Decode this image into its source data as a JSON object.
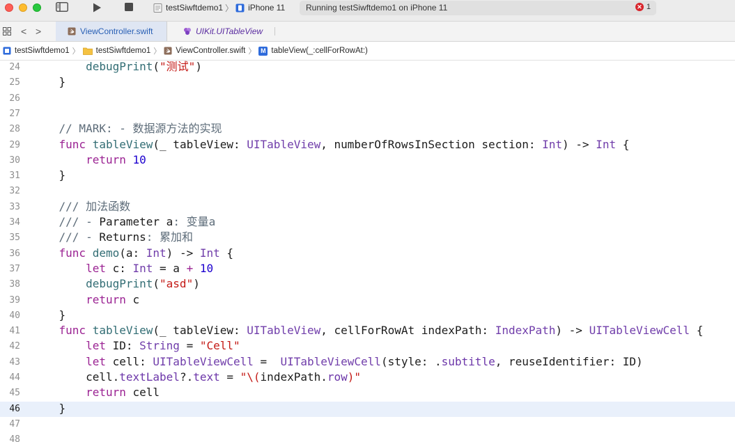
{
  "toolbar": {
    "scheme_project": "testSiwftdemo1",
    "device": "iPhone 11",
    "status_text": "Running testSiwftdemo1 on iPhone 11",
    "error_count": "1"
  },
  "tabs": {
    "active_label": "ViewController.swift",
    "other_label": "UIKit.UITableView"
  },
  "breadcrumb": {
    "project": "testSiwftdemo1",
    "folder": "testSiwftdemo1",
    "file": "ViewController.swift",
    "method_badge": "M",
    "method": "tableView(_:cellForRowAt:)"
  },
  "colors": {
    "keyword": "#9b2393",
    "type": "#703daa",
    "string": "#c41a16",
    "number": "#1c00cf",
    "function": "#326d74",
    "comment": "#5d6c79",
    "current_line": "#e9f0fb"
  },
  "editor": {
    "current_line": "46",
    "lines": [
      {
        "n": "24",
        "tokens": [
          [
            "sp",
            "        "
          ],
          [
            "fn",
            "debugPrint"
          ],
          [
            "sp",
            "("
          ],
          [
            "str",
            "\"测试\""
          ],
          [
            "sp",
            ")"
          ]
        ]
      },
      {
        "n": "25",
        "tokens": [
          [
            "sp",
            "    }"
          ]
        ]
      },
      {
        "n": "26",
        "tokens": []
      },
      {
        "n": "27",
        "tokens": []
      },
      {
        "n": "28",
        "tokens": [
          [
            "sp",
            "    "
          ],
          [
            "cm",
            "// MARK: - 数据源方法的实现"
          ]
        ]
      },
      {
        "n": "29",
        "tokens": [
          [
            "sp",
            "    "
          ],
          [
            "kw",
            "func"
          ],
          [
            "sp",
            " "
          ],
          [
            "fn",
            "tableView"
          ],
          [
            "sp",
            "(_ tableView: "
          ],
          [
            "ty",
            "UITableView"
          ],
          [
            "sp",
            ", numberOfRowsInSection section: "
          ],
          [
            "ty",
            "Int"
          ],
          [
            "sp",
            ") -> "
          ],
          [
            "ty",
            "Int"
          ],
          [
            "sp",
            " {"
          ]
        ]
      },
      {
        "n": "30",
        "tokens": [
          [
            "sp",
            "        "
          ],
          [
            "kw",
            "return"
          ],
          [
            "sp",
            " "
          ],
          [
            "num",
            "10"
          ]
        ]
      },
      {
        "n": "31",
        "tokens": [
          [
            "sp",
            "    }"
          ]
        ]
      },
      {
        "n": "32",
        "tokens": []
      },
      {
        "n": "33",
        "tokens": [
          [
            "sp",
            "    "
          ],
          [
            "cm",
            "/// 加法函数"
          ]
        ]
      },
      {
        "n": "34",
        "tokens": [
          [
            "sp",
            "    "
          ],
          [
            "cm",
            "/// - "
          ],
          [
            "cmt",
            "Parameter"
          ],
          [
            "cm",
            " "
          ],
          [
            "cmt",
            "a"
          ],
          [
            "cm",
            ": 变量a"
          ]
        ]
      },
      {
        "n": "35",
        "tokens": [
          [
            "sp",
            "    "
          ],
          [
            "cm",
            "/// - "
          ],
          [
            "cmt",
            "Returns"
          ],
          [
            "cm",
            ": 累加和"
          ]
        ]
      },
      {
        "n": "36",
        "tokens": [
          [
            "sp",
            "    "
          ],
          [
            "kw",
            "func"
          ],
          [
            "sp",
            " "
          ],
          [
            "fn",
            "demo"
          ],
          [
            "sp",
            "(a: "
          ],
          [
            "ty",
            "Int"
          ],
          [
            "sp",
            ") -> "
          ],
          [
            "ty",
            "Int"
          ],
          [
            "sp",
            " {"
          ]
        ]
      },
      {
        "n": "37",
        "tokens": [
          [
            "sp",
            "        "
          ],
          [
            "kw",
            "let"
          ],
          [
            "sp",
            " c: "
          ],
          [
            "ty",
            "Int"
          ],
          [
            "sp",
            " = a "
          ],
          [
            "kw",
            "+"
          ],
          [
            "sp",
            " "
          ],
          [
            "num",
            "10"
          ]
        ]
      },
      {
        "n": "38",
        "tokens": [
          [
            "sp",
            "        "
          ],
          [
            "fn",
            "debugPrint"
          ],
          [
            "sp",
            "("
          ],
          [
            "str",
            "\"asd\""
          ],
          [
            "sp",
            ")"
          ]
        ]
      },
      {
        "n": "39",
        "tokens": [
          [
            "sp",
            "        "
          ],
          [
            "kw",
            "return"
          ],
          [
            "sp",
            " c"
          ]
        ]
      },
      {
        "n": "40",
        "tokens": [
          [
            "sp",
            "    }"
          ]
        ]
      },
      {
        "n": "41",
        "tokens": [
          [
            "sp",
            "    "
          ],
          [
            "kw",
            "func"
          ],
          [
            "sp",
            " "
          ],
          [
            "fn",
            "tableView"
          ],
          [
            "sp",
            "(_ tableView: "
          ],
          [
            "ty",
            "UITableView"
          ],
          [
            "sp",
            ", cellForRowAt indexPath: "
          ],
          [
            "ty",
            "IndexPath"
          ],
          [
            "sp",
            ") -> "
          ],
          [
            "ty",
            "UITableViewCell"
          ],
          [
            "sp",
            " {"
          ]
        ]
      },
      {
        "n": "42",
        "tokens": [
          [
            "sp",
            "        "
          ],
          [
            "kw",
            "let"
          ],
          [
            "sp",
            " ID: "
          ],
          [
            "ty",
            "String"
          ],
          [
            "sp",
            " = "
          ],
          [
            "str",
            "\"Cell\""
          ]
        ]
      },
      {
        "n": "43",
        "tokens": [
          [
            "sp",
            "        "
          ],
          [
            "kw",
            "let"
          ],
          [
            "sp",
            " cell: "
          ],
          [
            "ty",
            "UITableViewCell"
          ],
          [
            "sp",
            " =  "
          ],
          [
            "ty",
            "UITableViewCell"
          ],
          [
            "sp",
            "(style: ."
          ],
          [
            "prop",
            "subtitle"
          ],
          [
            "sp",
            ", reuseIdentifier: ID)"
          ]
        ]
      },
      {
        "n": "44",
        "tokens": [
          [
            "sp",
            "        cell."
          ],
          [
            "prop",
            "textLabel"
          ],
          [
            "sp",
            "?."
          ],
          [
            "prop",
            "text"
          ],
          [
            "sp",
            " = "
          ],
          [
            "str",
            "\"\\("
          ],
          [
            "sp",
            "indexPath."
          ],
          [
            "prop",
            "row"
          ],
          [
            "str",
            ")\""
          ]
        ]
      },
      {
        "n": "45",
        "tokens": [
          [
            "sp",
            "        "
          ],
          [
            "kw",
            "return"
          ],
          [
            "sp",
            " cell"
          ]
        ]
      },
      {
        "n": "46",
        "tokens": [
          [
            "sp",
            "    }"
          ]
        ]
      },
      {
        "n": "47",
        "tokens": []
      },
      {
        "n": "48",
        "tokens": []
      }
    ]
  }
}
